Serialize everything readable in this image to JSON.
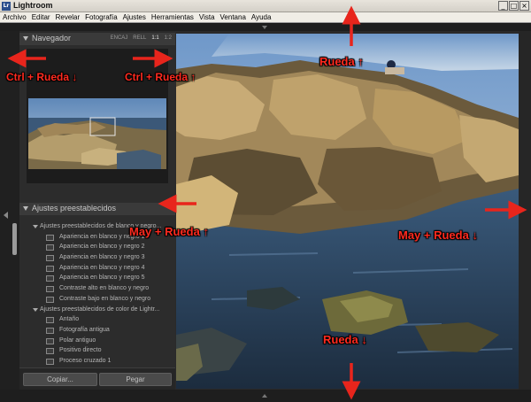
{
  "window": {
    "title": "Lightroom",
    "icon_text": "Lr",
    "controls": [
      "_",
      "□",
      "×"
    ]
  },
  "menu": [
    "Archivo",
    "Editar",
    "Revelar",
    "Fotografía",
    "Ajustes",
    "Herramientas",
    "Vista",
    "Ventana",
    "Ayuda"
  ],
  "navigator": {
    "title": "Navegador",
    "zoom_options": [
      "ENCAJ",
      "RELL",
      "1:1",
      "1:2"
    ],
    "active_zoom": "1:1"
  },
  "presets": {
    "title": "Ajustes preestablecidos",
    "folders": [
      {
        "label": "Ajustes preestablecidos de blanco y negro...",
        "items": [
          "Apariencia en blanco y negro 1",
          "Apariencia en blanco y negro 2",
          "Apariencia en blanco y negro 3",
          "Apariencia en blanco y negro 4",
          "Apariencia en blanco y negro 5",
          "Contraste alto en blanco y negro",
          "Contraste bajo en blanco y negro"
        ]
      },
      {
        "label": "Ajustes preestablecidos de color de Lightr...",
        "items": [
          "Antaño",
          "Fotografía antigua",
          "Polar antiguo",
          "Positivo directo",
          "Proceso cruzado 1"
        ]
      }
    ]
  },
  "buttons": {
    "copy": "Copiar...",
    "paste": "Pegar"
  },
  "annotations": {
    "ctrl_left": "Ctrl + Rueda ↓",
    "ctrl_right": "Ctrl + Rueda ↑",
    "rueda_top": "Rueda ↑",
    "may_left": "May + Rueda ↑",
    "may_right": "May + Rueda ↓",
    "rueda_bottom": "Rueda ↓"
  },
  "colors": {
    "annotation": "#ff2a1f",
    "panel_bg": "#2c2c2c",
    "header_bg": "#3a3a3a"
  }
}
